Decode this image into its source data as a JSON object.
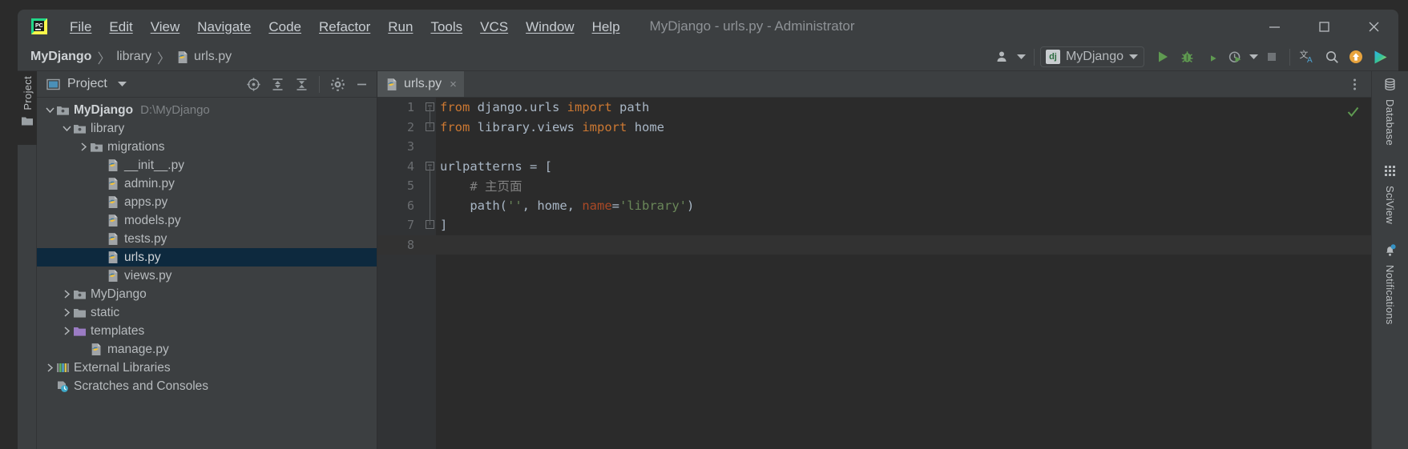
{
  "window": {
    "title": "MyDjango - urls.py - Administrator",
    "app_icon": "pycharm-logo-icon",
    "controls": [
      {
        "name": "minimize",
        "glyph": "minimize-icon"
      },
      {
        "name": "maximize",
        "glyph": "maximize-icon"
      },
      {
        "name": "close",
        "glyph": "close-icon"
      }
    ]
  },
  "menubar": {
    "items": [
      {
        "label": "File",
        "mnemonic": "F"
      },
      {
        "label": "Edit",
        "mnemonic": "E"
      },
      {
        "label": "View",
        "mnemonic": "V"
      },
      {
        "label": "Navigate",
        "mnemonic": "N"
      },
      {
        "label": "Code",
        "mnemonic": "C"
      },
      {
        "label": "Refactor",
        "mnemonic": "R"
      },
      {
        "label": "Run",
        "mnemonic": "u"
      },
      {
        "label": "Tools",
        "mnemonic": "T"
      },
      {
        "label": "VCS",
        "mnemonic": "S"
      },
      {
        "label": "Window",
        "mnemonic": "W"
      },
      {
        "label": "Help",
        "mnemonic": "H"
      }
    ]
  },
  "navbar": {
    "breadcrumbs": [
      {
        "label": "MyDjango",
        "icon": "",
        "bold": true
      },
      {
        "label": "library",
        "icon": "",
        "bold": false
      },
      {
        "label": "urls.py",
        "icon": "python-file-icon",
        "bold": false
      }
    ],
    "separator": "〉",
    "run_config": {
      "badge": "dj",
      "label": "MyDjango",
      "dropdown": "chevron-down-icon"
    },
    "actions": [
      {
        "name": "run-button",
        "icon": "play-icon",
        "color": "#5f9a51"
      },
      {
        "name": "debug-button",
        "icon": "bug-icon",
        "color": "#5f9a51"
      },
      {
        "name": "run-with-coverage-button",
        "icon": "coverage-icon",
        "color": "#5f9a51"
      },
      {
        "name": "profile-button",
        "icon": "profile-clock-icon",
        "color": "#5f9a51"
      },
      {
        "name": "stop-button",
        "icon": "stop-square-icon",
        "color": "#6f7376"
      },
      {
        "name": "translate-button",
        "icon": "translate-icon",
        "color": "#b4b8bb"
      },
      {
        "name": "search-everywhere-button",
        "icon": "search-icon",
        "color": "#b4b8bb"
      },
      {
        "name": "update-button",
        "icon": "orange-arrow-up-icon",
        "color": "#e8a33d"
      },
      {
        "name": "run-anything-button",
        "icon": "colorful-play-icon",
        "color": "#34c3a0"
      }
    ],
    "user_icon": "user-settings-icon"
  },
  "left_rail": {
    "tab_label": "Project",
    "tab_icon": "folder-icon"
  },
  "project_panel": {
    "title": "Project",
    "dropdown": "chevron-down-icon",
    "toolbar_icons": [
      {
        "name": "select-opened-file-icon"
      },
      {
        "name": "expand-all-icon"
      },
      {
        "name": "collapse-all-icon"
      },
      {
        "name": "settings-gear-icon"
      },
      {
        "name": "hide-panel-icon"
      }
    ],
    "tree": [
      {
        "label": "MyDjango",
        "sublabel": "D:\\MyDjango",
        "depth": 0,
        "arrow": "expanded",
        "icon": "folder-project-icon",
        "bold": true,
        "selected": false
      },
      {
        "label": "library",
        "sublabel": "",
        "depth": 1,
        "arrow": "expanded",
        "icon": "folder-module-icon",
        "bold": false,
        "selected": false
      },
      {
        "label": "migrations",
        "sublabel": "",
        "depth": 2,
        "arrow": "collapsed",
        "icon": "folder-module-icon",
        "bold": false,
        "selected": false
      },
      {
        "label": "__init__.py",
        "sublabel": "",
        "depth": 3,
        "arrow": "none",
        "icon": "python-file-icon",
        "bold": false,
        "selected": false
      },
      {
        "label": "admin.py",
        "sublabel": "",
        "depth": 3,
        "arrow": "none",
        "icon": "python-file-icon",
        "bold": false,
        "selected": false
      },
      {
        "label": "apps.py",
        "sublabel": "",
        "depth": 3,
        "arrow": "none",
        "icon": "python-file-icon",
        "bold": false,
        "selected": false
      },
      {
        "label": "models.py",
        "sublabel": "",
        "depth": 3,
        "arrow": "none",
        "icon": "python-file-icon",
        "bold": false,
        "selected": false
      },
      {
        "label": "tests.py",
        "sublabel": "",
        "depth": 3,
        "arrow": "none",
        "icon": "python-file-icon",
        "bold": false,
        "selected": false
      },
      {
        "label": "urls.py",
        "sublabel": "",
        "depth": 3,
        "arrow": "none",
        "icon": "python-file-icon",
        "bold": false,
        "selected": true
      },
      {
        "label": "views.py",
        "sublabel": "",
        "depth": 3,
        "arrow": "none",
        "icon": "python-file-icon",
        "bold": false,
        "selected": false
      },
      {
        "label": "MyDjango",
        "sublabel": "",
        "depth": 1,
        "arrow": "collapsed",
        "icon": "folder-module-icon",
        "bold": false,
        "selected": false
      },
      {
        "label": "static",
        "sublabel": "",
        "depth": 1,
        "arrow": "collapsed",
        "icon": "folder-icon",
        "bold": false,
        "selected": false
      },
      {
        "label": "templates",
        "sublabel": "",
        "depth": 1,
        "arrow": "collapsed",
        "icon": "folder-templates-icon",
        "bold": false,
        "selected": false
      },
      {
        "label": "manage.py",
        "sublabel": "",
        "depth": 2,
        "arrow": "none",
        "icon": "python-file-icon",
        "bold": false,
        "selected": false
      },
      {
        "label": "External Libraries",
        "sublabel": "",
        "depth": 0,
        "arrow": "collapsed",
        "icon": "external-libraries-icon",
        "bold": false,
        "selected": false
      },
      {
        "label": "Scratches and Consoles",
        "sublabel": "",
        "depth": 0,
        "arrow": "none",
        "icon": "scratches-icon",
        "bold": false,
        "selected": false
      }
    ]
  },
  "editor": {
    "tabs": [
      {
        "label": "urls.py",
        "icon": "python-file-icon",
        "close": "×",
        "active": true
      }
    ],
    "more_icon": "more-vertical-icon",
    "inspection_status": "inspection-ok-checkmark",
    "filename": "urls.py",
    "lines": [
      {
        "no": "1",
        "fold": "start",
        "tokens": [
          {
            "t": "from",
            "c": "kw"
          },
          {
            "t": " ",
            "c": "id"
          },
          {
            "t": "django.urls",
            "c": "id"
          },
          {
            "t": " ",
            "c": "id"
          },
          {
            "t": "import",
            "c": "kw"
          },
          {
            "t": " ",
            "c": "id"
          },
          {
            "t": "path",
            "c": "id"
          }
        ]
      },
      {
        "no": "2",
        "fold": "end",
        "tokens": [
          {
            "t": "from",
            "c": "kw"
          },
          {
            "t": " ",
            "c": "id"
          },
          {
            "t": "library.views",
            "c": "id"
          },
          {
            "t": " ",
            "c": "id"
          },
          {
            "t": "import",
            "c": "kw"
          },
          {
            "t": " ",
            "c": "id"
          },
          {
            "t": "home",
            "c": "id"
          }
        ]
      },
      {
        "no": "3",
        "fold": "none",
        "tokens": []
      },
      {
        "no": "4",
        "fold": "start",
        "tokens": [
          {
            "t": "urlpatterns",
            "c": "id"
          },
          {
            "t": " = [",
            "c": "id"
          }
        ]
      },
      {
        "no": "5",
        "fold": "none",
        "tokens": [
          {
            "t": "    # 主页面",
            "c": "cmt"
          }
        ]
      },
      {
        "no": "6",
        "fold": "none",
        "tokens": [
          {
            "t": "    ",
            "c": "id"
          },
          {
            "t": "path",
            "c": "fn"
          },
          {
            "t": "(",
            "c": "id"
          },
          {
            "t": "''",
            "c": "str"
          },
          {
            "t": ", home, ",
            "c": "id"
          },
          {
            "t": "name",
            "c": "named"
          },
          {
            "t": "=",
            "c": "id"
          },
          {
            "t": "'library'",
            "c": "str"
          },
          {
            "t": ")",
            "c": "id"
          }
        ]
      },
      {
        "no": "7",
        "fold": "end",
        "tokens": [
          {
            "t": "]",
            "c": "id"
          }
        ]
      },
      {
        "no": "8",
        "fold": "none",
        "tokens": [],
        "current": true
      }
    ]
  },
  "right_rail": {
    "items": [
      {
        "label": "Database",
        "icon": "database-icon",
        "badge": false
      },
      {
        "label": "SciView",
        "icon": "sciview-grid-icon",
        "badge": false
      },
      {
        "label": "Notifications",
        "icon": "bell-icon",
        "badge": true
      }
    ]
  },
  "colors": {
    "bg_panel": "#3c3f41",
    "bg_editor": "#2b2b2b",
    "bg_gutter": "#313335",
    "selection": "#0d293e",
    "keyword": "#cc7832",
    "string": "#6a8759",
    "comment": "#808080",
    "named_arg": "#aa4926",
    "text": "#a9b7c6",
    "accent_green": "#5f9a51",
    "accent_orange": "#e8a33d"
  }
}
